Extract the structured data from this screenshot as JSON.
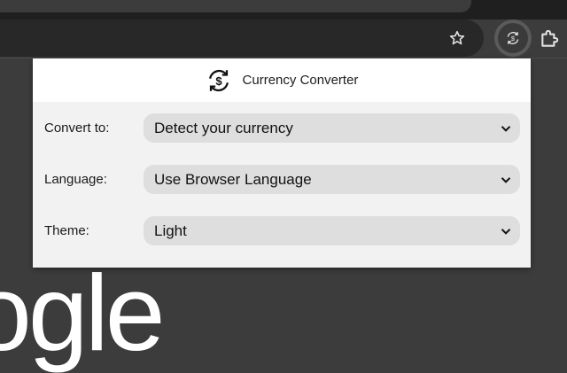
{
  "browser": {
    "colors": {
      "frame": "#1f1f1f",
      "toolbar": "#3c3c3c",
      "omnibox": "#282828",
      "page_background": "#3c3c3c"
    },
    "toolbar": {
      "bookmark_icon": "star-icon",
      "extension_icon": "currency-converter-icon",
      "extensions_menu_icon": "puzzle-icon"
    },
    "page": {
      "logo_fragment": "ogle"
    }
  },
  "popup": {
    "header": {
      "icon": "currency-exchange-icon",
      "title": "Currency Converter"
    },
    "colors": {
      "header_background": "#ffffff",
      "body_background": "#f2f2f2",
      "select_background": "#dedede"
    },
    "settings": [
      {
        "label": "Convert to:",
        "value": "Detect your currency"
      },
      {
        "label": "Language:",
        "value": "Use Browser Language"
      },
      {
        "label": "Theme:",
        "value": "Light"
      }
    ]
  }
}
